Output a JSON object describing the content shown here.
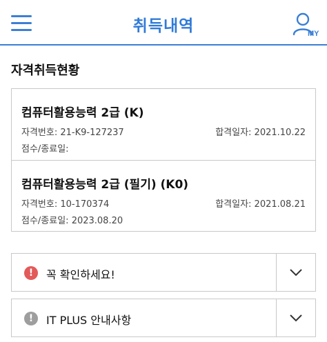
{
  "header": {
    "title": "취득내역",
    "my_label": "MY",
    "accent_color": "#3b7fd6"
  },
  "section": {
    "title": "자격취득현황"
  },
  "certificates": [
    {
      "name": "컴퓨터활용능력 2급 (K)",
      "number": "자격번호: 21-K9-127237",
      "pass_date": "합격일자: 2021.10.22",
      "score": "점수/종료일:"
    },
    {
      "name": "컴퓨터활용능력 2급 (필기) (K0)",
      "number": "자격번호: 10-170374",
      "pass_date": "합격일자: 2021.08.21",
      "score": "점수/종료일: 2023.08.20"
    }
  ],
  "accordions": [
    {
      "label": "꼭 확인하세요!",
      "icon": "alert-circle-icon",
      "icon_glyph": "!",
      "icon_color": "#e35a5a"
    },
    {
      "label": "IT PLUS 안내사항",
      "icon": "info-circle-icon",
      "icon_glyph": "!",
      "icon_color": "#9e9e9e"
    }
  ]
}
